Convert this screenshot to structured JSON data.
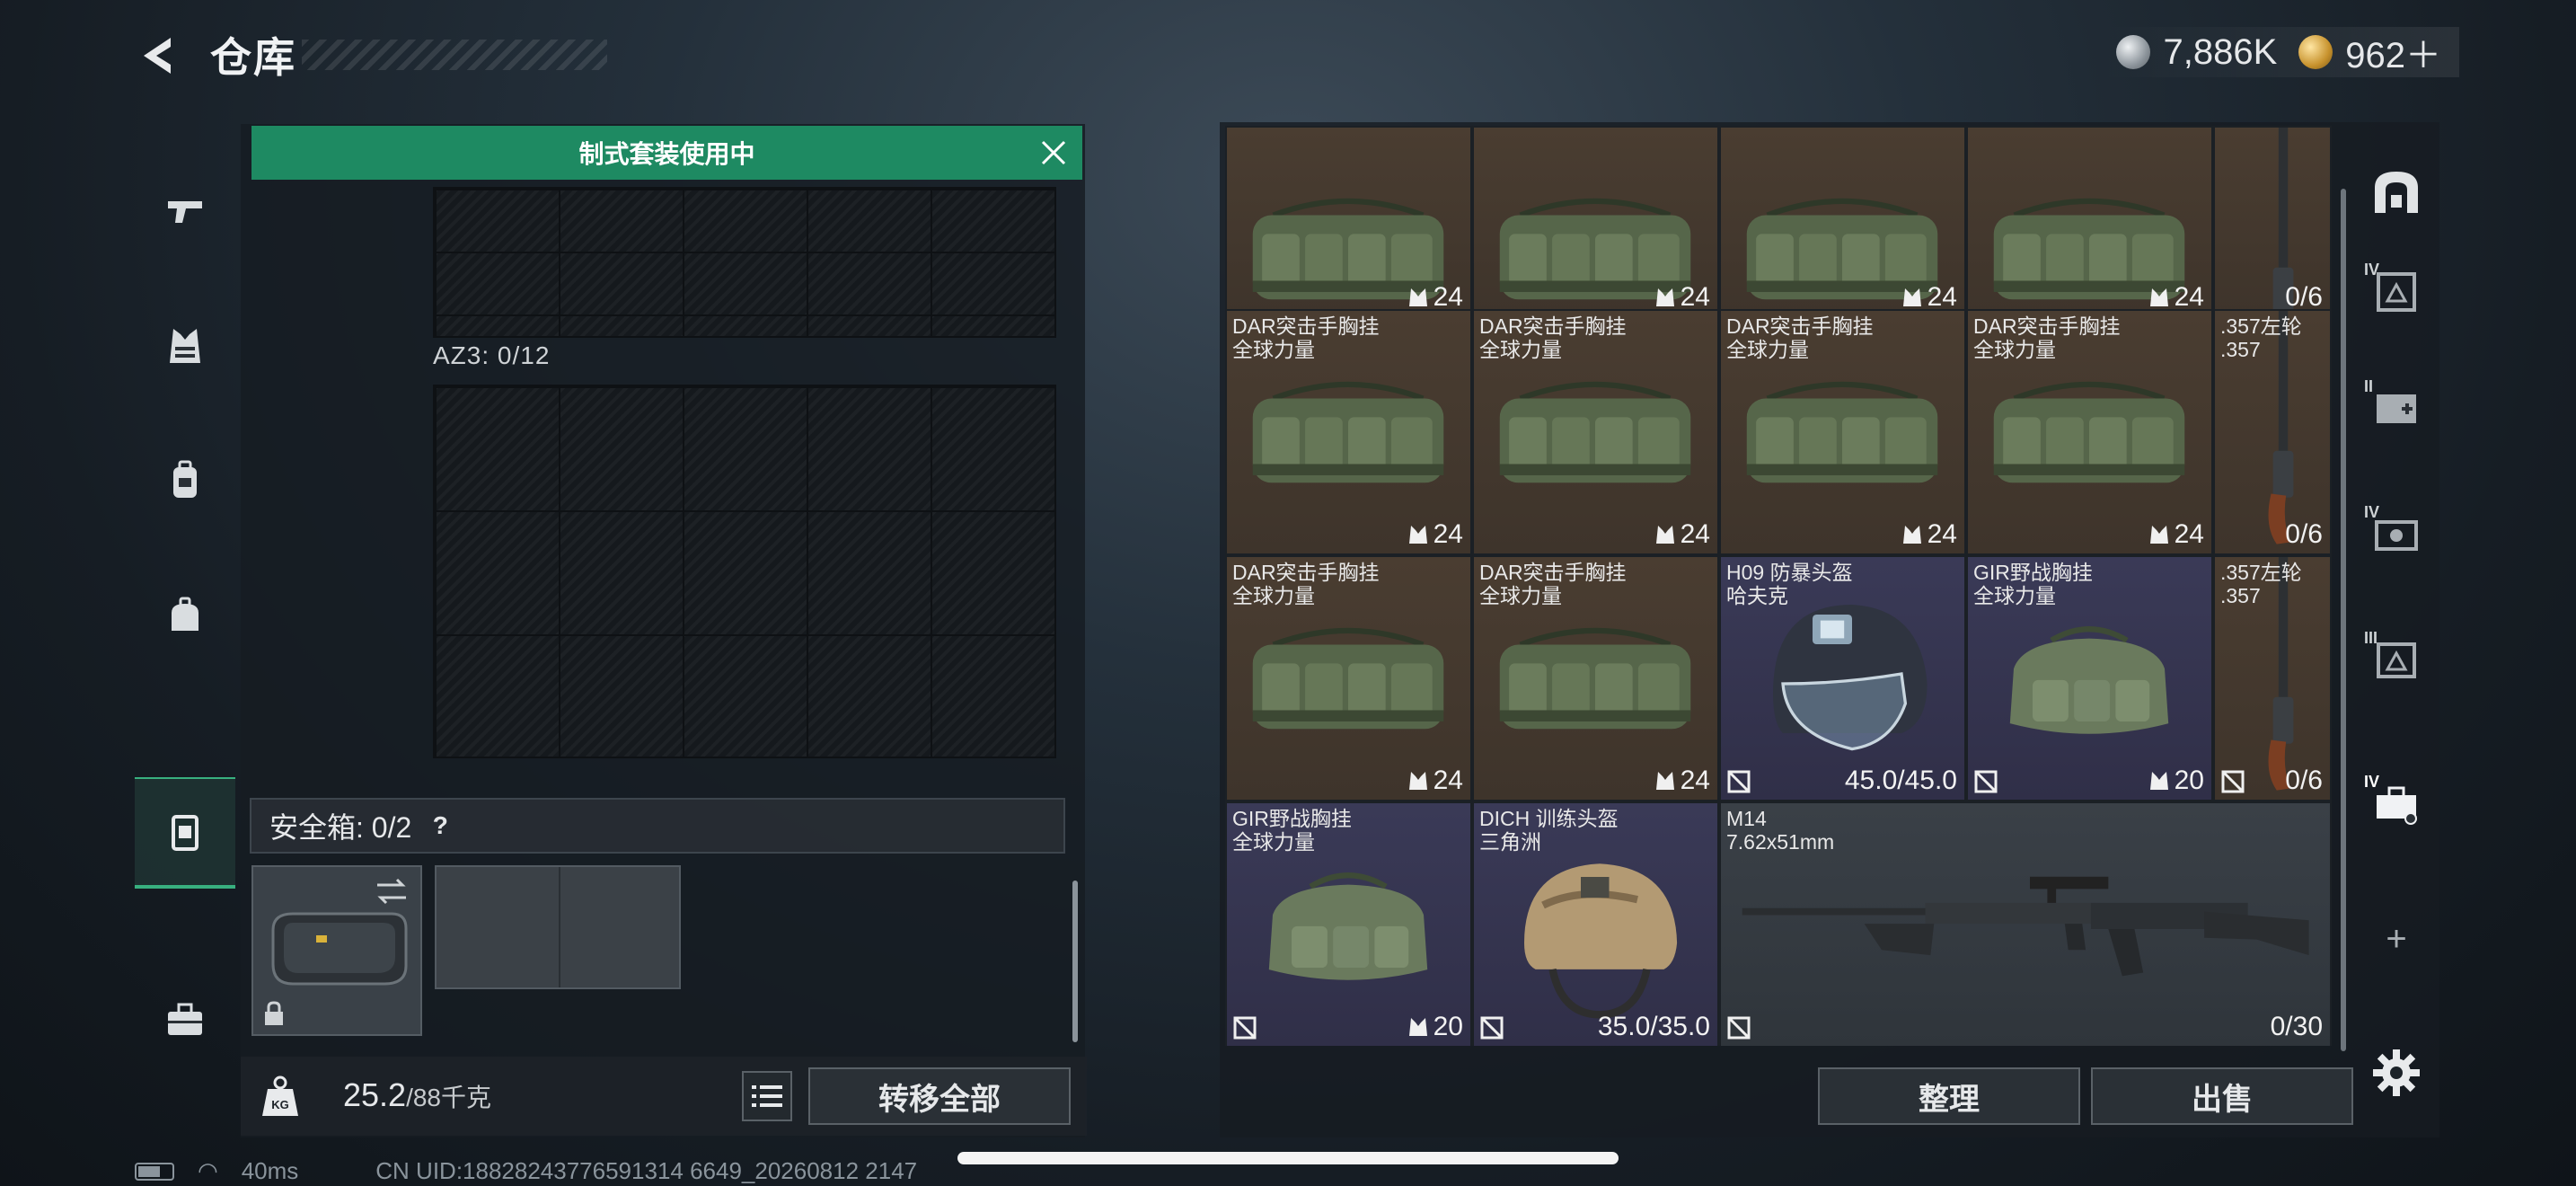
{
  "header": {
    "title": "仓库",
    "currency_silver": "7,886K",
    "currency_gold": "962＋"
  },
  "left_nav": {
    "items": [
      "weapon-icon",
      "vest-icon",
      "backpack-icon",
      "helmet-bag-icon",
      "safebox-icon",
      "toolbox-icon"
    ],
    "active": "safebox-icon"
  },
  "kit": {
    "banner": "制式套装使用中"
  },
  "backpack": {
    "az3_label": "AZ3: 0/12"
  },
  "safebox": {
    "label": "安全箱: 0/2",
    "help": "?"
  },
  "bottom_left": {
    "weight_value": "25.2",
    "weight_unit": "/88千克",
    "transfer_all": "转移全部"
  },
  "stash": {
    "items": [
      {
        "name1": "",
        "name2": "",
        "count": "24",
        "type": "bag",
        "bg": "brown"
      },
      {
        "name1": "",
        "name2": "",
        "count": "24",
        "type": "bag",
        "bg": "brown"
      },
      {
        "name1": "",
        "name2": "",
        "count": "24",
        "type": "bag",
        "bg": "brown"
      },
      {
        "name1": "",
        "name2": "",
        "count": "24",
        "type": "bag",
        "bg": "brown"
      },
      {
        "name1": "",
        "name2": "",
        "count": "0/6",
        "type": "revolver",
        "bg": "brown"
      },
      {
        "name1": "DAR突击手胸挂",
        "name2": "全球力量",
        "count": "24",
        "type": "bag",
        "bg": "brown"
      },
      {
        "name1": "DAR突击手胸挂",
        "name2": "全球力量",
        "count": "24",
        "type": "bag",
        "bg": "brown"
      },
      {
        "name1": "DAR突击手胸挂",
        "name2": "全球力量",
        "count": "24",
        "type": "bag",
        "bg": "brown"
      },
      {
        "name1": "DAR突击手胸挂",
        "name2": "全球力量",
        "count": "24",
        "type": "bag",
        "bg": "brown"
      },
      {
        "name1": ".357左轮",
        "name2": ".357",
        "count": "0/6",
        "type": "revolver",
        "bg": "brown"
      },
      {
        "name1": "DAR突击手胸挂",
        "name2": "全球力量",
        "count": "24",
        "type": "bag",
        "bg": "brown"
      },
      {
        "name1": "DAR突击手胸挂",
        "name2": "全球力量",
        "count": "24",
        "type": "bag",
        "bg": "brown"
      },
      {
        "name1": "H09 防暴头盔",
        "name2": "哈夫克",
        "count": "45.0/45.0",
        "type": "riot-helmet",
        "bg": "purple"
      },
      {
        "name1": "GIR野战胸挂",
        "name2": "全球力量",
        "count": "20",
        "type": "small-bag",
        "bg": "purple"
      },
      {
        "name1": ".357左轮",
        "name2": ".357",
        "count": "0/6",
        "type": "revolver",
        "bg": "brown"
      },
      {
        "name1": "GIR野战胸挂",
        "name2": "全球力量",
        "count": "20",
        "type": "small-bag",
        "bg": "purple"
      },
      {
        "name1": "DICH 训练头盔",
        "name2": "三角洲",
        "count": "35.0/35.0",
        "type": "tan-helmet",
        "bg": "purple"
      },
      {
        "name1": "M14",
        "name2": "7.62x51mm",
        "count": "0/30",
        "type": "rifle",
        "bg": "gray"
      }
    ]
  },
  "right_nav": {
    "tiers": [
      "",
      "IV",
      "II",
      "IV",
      "III",
      "IV"
    ],
    "add": "+"
  },
  "actions": {
    "sort": "整理",
    "sell": "出售"
  },
  "status": {
    "ping": "40ms",
    "uid": "CN UID:18828243776591314 6649_20260812 2147"
  },
  "colors": {
    "accent_green": "#1e8a62",
    "item_brown": "#4a3d31",
    "item_purple": "#3a3a57",
    "item_gray": "#3a4047"
  }
}
